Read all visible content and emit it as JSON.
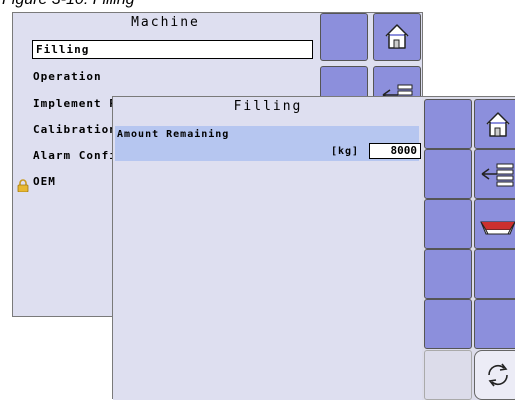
{
  "caption": "Figure 3-10: Filling",
  "machine": {
    "title": "Machine",
    "items": [
      {
        "label": "Filling"
      },
      {
        "label": "Operation"
      },
      {
        "label": "Implement P"
      },
      {
        "label": "Calibration"
      },
      {
        "label": "Alarm Confi"
      },
      {
        "label": "OEM"
      }
    ],
    "buttons": [
      {
        "icon": "home-icon"
      },
      {
        "icon": "back-menu-icon"
      }
    ]
  },
  "filling": {
    "title": "Filling",
    "amount_label": "Amount Remaining",
    "unit": "[kg]",
    "amount_value": "8000",
    "buttons": [
      {
        "icon": "home-icon"
      },
      {
        "icon": "back-menu-icon"
      },
      {
        "icon": "tank-icon"
      },
      {
        "icon": "refresh-icon"
      }
    ]
  },
  "colors": {
    "panel_bg": "#dedff0",
    "button_bg": "#8c8fdc",
    "highlight_row": "#b6c6f0"
  }
}
